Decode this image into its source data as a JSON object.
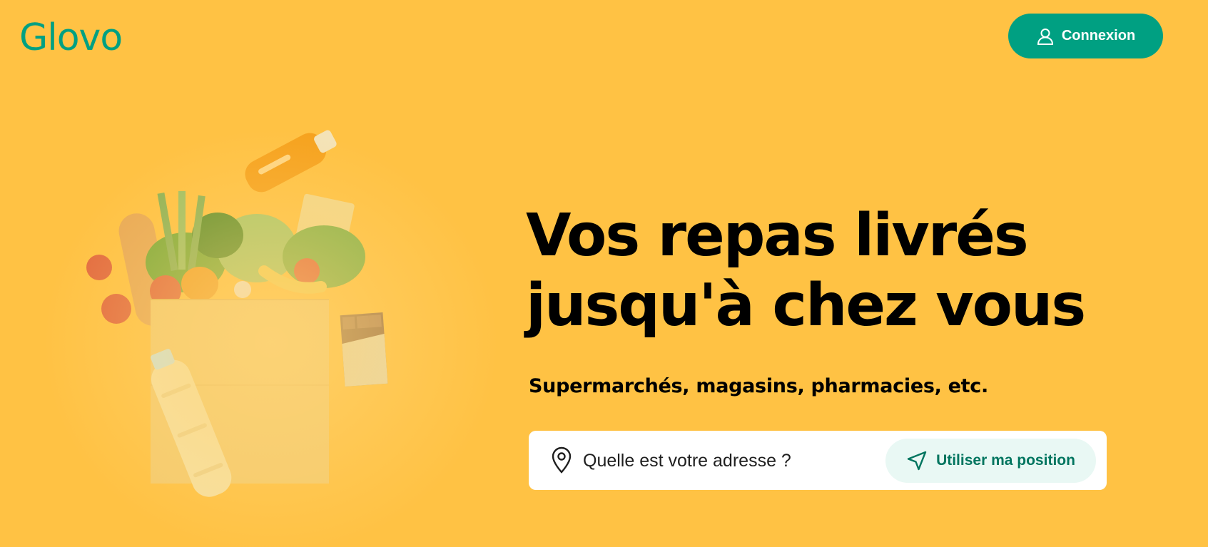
{
  "header": {
    "logo_text": "Glovo",
    "login_label": "Connexion",
    "login_icon": "user-icon"
  },
  "hero": {
    "title_line1": "Vos repas livrés",
    "title_line2": "jusqu'à chez vous",
    "subtitle": "Supermarchés, magasins, pharmacies, etc."
  },
  "address": {
    "placeholder": "Quelle est votre adresse ?",
    "value": "",
    "pin_icon": "location-pin-icon",
    "use_position_label": "Utiliser ma position",
    "use_position_icon": "navigation-arrow-icon"
  },
  "illustration": {
    "description_icon": "grocery-bag-icon"
  },
  "colors": {
    "background": "#FFC244",
    "brand": "#00A082",
    "position_button_bg": "#E9F8F4",
    "position_button_text": "#00755F"
  }
}
